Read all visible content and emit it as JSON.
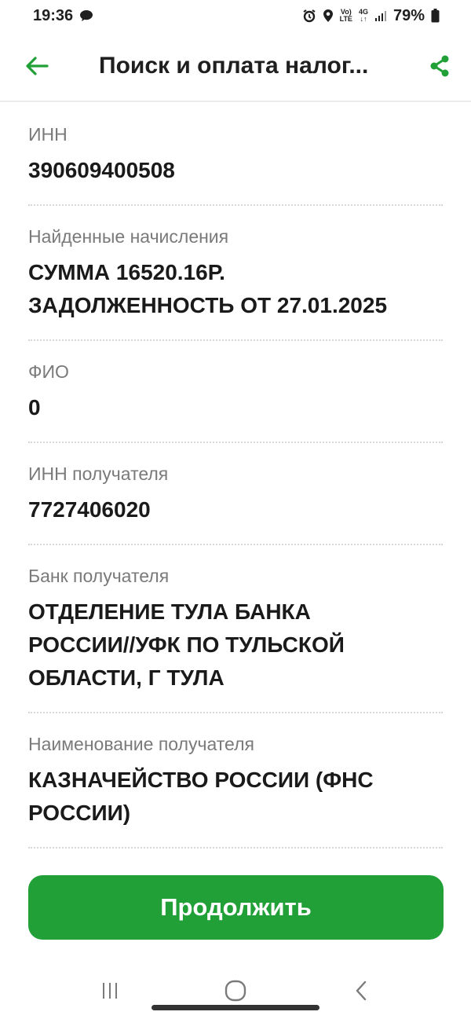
{
  "status_bar": {
    "time": "19:36",
    "network_top": "Vo)",
    "network_bottom": "LTE",
    "data_top": "4G",
    "data_bottom": "↓↑",
    "battery": "79%"
  },
  "header": {
    "title": "Поиск и оплата налог..."
  },
  "fields": [
    {
      "label": "ИНН",
      "value": "390609400508"
    },
    {
      "label": "Найденные начисления",
      "value_lines": [
        "СУММА 16520.16Р.",
        "ЗАДОЛЖЕННОСТЬ ОТ 27.01.2025"
      ]
    },
    {
      "label": "ФИО",
      "value": "0"
    },
    {
      "label": "ИНН получателя",
      "value": "7727406020"
    },
    {
      "label": "Банк получателя",
      "value_lines": [
        "ОТДЕЛЕНИЕ ТУЛА БАНКА",
        "РОССИИ//УФК ПО ТУЛЬСКОЙ",
        "ОБЛАСТИ, Г ТУЛА"
      ]
    },
    {
      "label": "Наименование получателя",
      "value_lines": [
        "КАЗНАЧЕЙСТВО РОССИИ (ФНС",
        "РОССИИ)"
      ]
    }
  ],
  "actions": {
    "continue_label": "Продолжить"
  },
  "colors": {
    "accent": "#21a038",
    "label": "#7a7a7a",
    "text": "#1a1a1a"
  },
  "icons": {
    "back": "arrow-left-icon",
    "share": "share-icon",
    "nav_recents": "recents-icon",
    "nav_home": "home-icon",
    "nav_back": "chevron-left-icon"
  }
}
